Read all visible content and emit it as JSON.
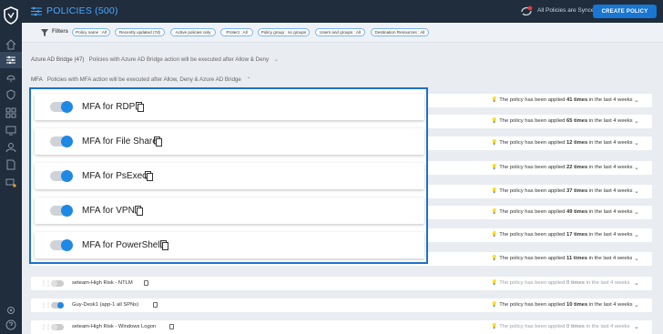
{
  "header": {
    "title": "POLICIES (500)",
    "sync_status": "All Policies are Synced",
    "create_button": "CREATE POLICY"
  },
  "filters": {
    "label": "Filters",
    "chips": [
      "Policy name : All",
      "Recently updated (7d)",
      "Active policies only",
      "Protect : All",
      "Policy group : no groups",
      "Users and groups : All",
      "Destination Resources : All"
    ]
  },
  "groups": {
    "azure": {
      "name": "Azure AD Bridge (47)",
      "desc": "Policies with Azure AD Bridge action will be executed after Allow & Deny"
    },
    "mfa": {
      "name": "MFA",
      "desc": "Policies with MFA action will be executed after Allow, Deny & Azure AD Bridge"
    }
  },
  "info": {
    "prefix": "The policy has been applied",
    "suffix": "in the last 4 weeks"
  },
  "background_rows": [
    {
      "count": "41 times",
      "muted": false
    },
    {
      "count": "65 times",
      "muted": false
    },
    {
      "count": "12 times",
      "muted": false
    },
    {
      "count": "22 times",
      "muted": false
    },
    {
      "count": "37 times",
      "muted": false
    },
    {
      "count": "49 times",
      "muted": false
    },
    {
      "count": "17 times",
      "muted": false
    },
    {
      "count": "11 times",
      "muted": false
    },
    {
      "name": "seteam-High Risk - NTLM",
      "count": "0 times",
      "muted": true,
      "active": false
    },
    {
      "name": "Guy-Desk1 (app-1 all SPNs)",
      "count": "10 times",
      "muted": false,
      "active": true
    },
    {
      "name": "seteam-High Risk - Windows Logon",
      "count": "0 times",
      "muted": true,
      "active": false
    }
  ],
  "highlighted_policies": [
    {
      "name": "MFA for RDP"
    },
    {
      "name": "MFA for File Share"
    },
    {
      "name": "MFA for PsExec"
    },
    {
      "name": "MFA for VPN"
    },
    {
      "name": "MFA for PowerShell"
    }
  ],
  "colors": {
    "accent": "#1e88e5",
    "highlight_border": "#1b72c9",
    "sidebar": "#1f2d3d"
  }
}
